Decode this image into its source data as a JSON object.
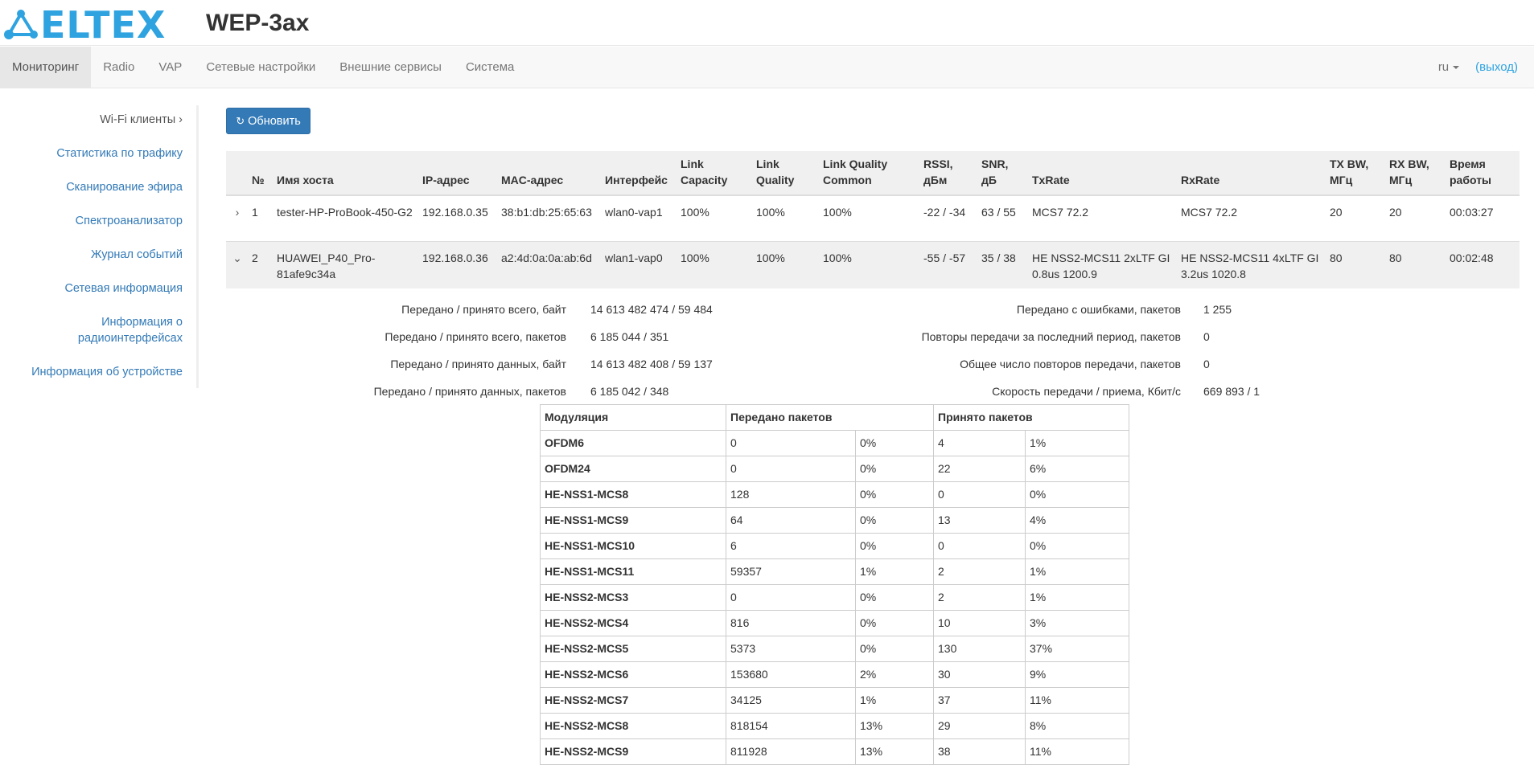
{
  "brand": "ELTEX",
  "product": "WEP-3ax",
  "nav": {
    "items": [
      "Мониторинг",
      "Radio",
      "VAP",
      "Сетевые настройки",
      "Внешние сервисы",
      "Система"
    ],
    "lang": "ru",
    "logout": "(выход)"
  },
  "sidebar": {
    "items": [
      "Wi-Fi клиенты ›",
      "Статистика по трафику",
      "Сканирование эфира",
      "Спектроанализатор",
      "Журнал событий",
      "Сетевая информация",
      "Информация о",
      "радиоинтерфейсах",
      "Информация об устройстве"
    ]
  },
  "refresh_label": "Обновить",
  "clients": {
    "headers": [
      "№",
      "Имя хоста",
      "IP-адрес",
      "MAC-адрес",
      "Интерфейс",
      "Link Capacity",
      "Link Quality",
      "Link Quality Common",
      "RSSI, дБм",
      "SNR, дБ",
      "TxRate",
      "RxRate",
      "TX BW, МГц",
      "RX BW, МГц",
      "Время работы"
    ],
    "rows": [
      [
        "1",
        "tester-HP-ProBook-450-G2",
        "192.168.0.35",
        "38:b1:db:25:65:63",
        "wlan0-vap1",
        "100%",
        "100%",
        "100%",
        "-22 / -34",
        "63 / 55",
        "MCS7 72.2",
        "MCS7 72.2",
        "20",
        "20",
        "00:03:27"
      ],
      [
        "2",
        "HUAWEI_P40_Pro-81afe9c34a",
        "192.168.0.36",
        "a2:4d:0a:0a:ab:6d",
        "wlan1-vap0",
        "100%",
        "100%",
        "100%",
        "-55 / -57",
        "35 / 38",
        "HE NSS2-MCS11 2xLTF GI 0.8us 1200.9",
        "HE NSS2-MCS11 4xLTF GI 3.2us 1020.8",
        "80",
        "80",
        "00:02:48"
      ]
    ]
  },
  "details": {
    "left": [
      {
        "label": "Передано / принято всего, байт",
        "value": "14 613 482 474 / 59 484"
      },
      {
        "label": "Передано / принято всего, пакетов",
        "value": "6 185 044 / 351"
      },
      {
        "label": "Передано / принято данных, байт",
        "value": "14 613 482 408 / 59 137"
      },
      {
        "label": "Передано / принято данных, пакетов",
        "value": "6 185 042 / 348"
      }
    ],
    "right": [
      {
        "label": "Передано с ошибками, пакетов",
        "value": "1 255"
      },
      {
        "label": "Повторы передачи за последний период, пакетов",
        "value": "0"
      },
      {
        "label": "Общее число повторов передачи, пакетов",
        "value": "0"
      },
      {
        "label": "Скорость передачи / приема, Кбит/с",
        "value": "669 893 / 1"
      }
    ]
  },
  "modulation": {
    "headers": [
      "Модуляция",
      "Передано пакетов",
      "Принято пакетов"
    ],
    "rows": [
      [
        "OFDM6",
        "0",
        "0%",
        "4",
        "1%"
      ],
      [
        "OFDM24",
        "0",
        "0%",
        "22",
        "6%"
      ],
      [
        "HE-NSS1-MCS8",
        "128",
        "0%",
        "0",
        "0%"
      ],
      [
        "HE-NSS1-MCS9",
        "64",
        "0%",
        "13",
        "4%"
      ],
      [
        "HE-NSS1-MCS10",
        "6",
        "0%",
        "0",
        "0%"
      ],
      [
        "HE-NSS1-MCS11",
        "59357",
        "1%",
        "2",
        "1%"
      ],
      [
        "HE-NSS2-MCS3",
        "0",
        "0%",
        "2",
        "1%"
      ],
      [
        "HE-NSS2-MCS4",
        "816",
        "0%",
        "10",
        "3%"
      ],
      [
        "HE-NSS2-MCS5",
        "5373",
        "0%",
        "130",
        "37%"
      ],
      [
        "HE-NSS2-MCS6",
        "153680",
        "2%",
        "30",
        "9%"
      ],
      [
        "HE-NSS2-MCS7",
        "34125",
        "1%",
        "37",
        "11%"
      ],
      [
        "HE-NSS2-MCS8",
        "818154",
        "13%",
        "29",
        "8%"
      ],
      [
        "HE-NSS2-MCS9",
        "811928",
        "13%",
        "38",
        "11%"
      ]
    ]
  }
}
